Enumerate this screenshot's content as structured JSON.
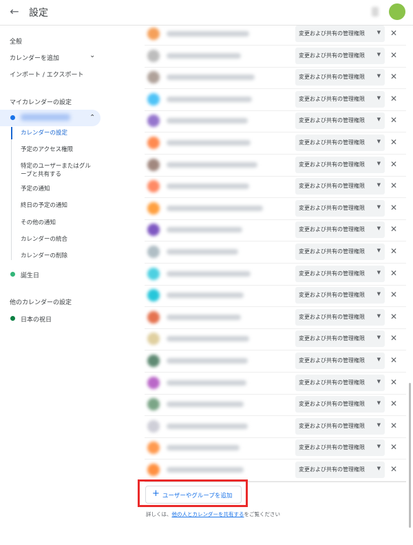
{
  "header": {
    "title": "設定"
  },
  "sidebar": {
    "general": "全般",
    "add_calendar": "カレンダーを追加",
    "import_export": "インポート / エクスポート",
    "my_calendars_heading": "マイカレンダーの設定",
    "my_calendar_name": "",
    "sub_items": [
      "カレンダーの設定",
      "予定のアクセス権限",
      "特定のユーザーまたはグループと共有する",
      "予定の通知",
      "終日の予定の通知",
      "その他の通知",
      "カレンダーの統合",
      "カレンダーの削除"
    ],
    "birthday": "誕生日",
    "other_calendars_heading": "他のカレンダーの設定",
    "japan_holidays": "日本の祝日",
    "colors": {
      "my_calendar_dot": "#1a73e8",
      "birthday_dot": "#33b679",
      "holiday_dot": "#0b8043",
      "accent": "#1967d2"
    }
  },
  "share": {
    "permission_label": "変更および共有の管理権限",
    "rows": [
      {
        "color": "#f5a05a"
      },
      {
        "color": "#bdbdbd"
      },
      {
        "color": "#b0a29a"
      },
      {
        "color": "#4fc3f7"
      },
      {
        "color": "#9575cd"
      },
      {
        "color": "#ff8a50"
      },
      {
        "color": "#a1887f"
      },
      {
        "color": "#ff8a65"
      },
      {
        "color": "#ffa040"
      },
      {
        "color": "#7e57c2"
      },
      {
        "color": "#b0bec5"
      },
      {
        "color": "#4dd0e1"
      },
      {
        "color": "#26c6da"
      },
      {
        "color": "#e57350"
      },
      {
        "color": "#e0d0a0"
      },
      {
        "color": "#5f8a73"
      },
      {
        "color": "#ba68c8"
      },
      {
        "color": "#7ba587"
      },
      {
        "color": "#cfcfd8"
      },
      {
        "color": "#ff9a50"
      },
      {
        "color": "#ff9040"
      }
    ],
    "add_button": "ユーザーやグループを追加",
    "help_prefix": "詳しくは、",
    "help_link": "他の人とカレンダーを共有する",
    "help_suffix": "をご覧ください"
  }
}
